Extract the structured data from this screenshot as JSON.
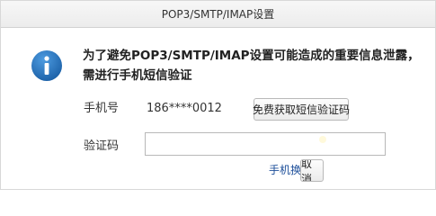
{
  "dialog": {
    "title": "POP3/SMTP/IMAP设置",
    "message": "为了避免POP3/SMTP/IMAP设置可能造成的重要信息泄露，需进行手机短信验证",
    "info_icon": "info-icon",
    "phone_label": "手机号",
    "phone_value": "186****0012",
    "get_code_button": "免费获取短信验证码",
    "code_label": "验证码",
    "code_input_value": "",
    "change_phone_link": "手机换",
    "cancel_button": "取消"
  },
  "colors": {
    "icon_blue": "#1f6fb8",
    "link_blue": "#1d4f9a"
  }
}
